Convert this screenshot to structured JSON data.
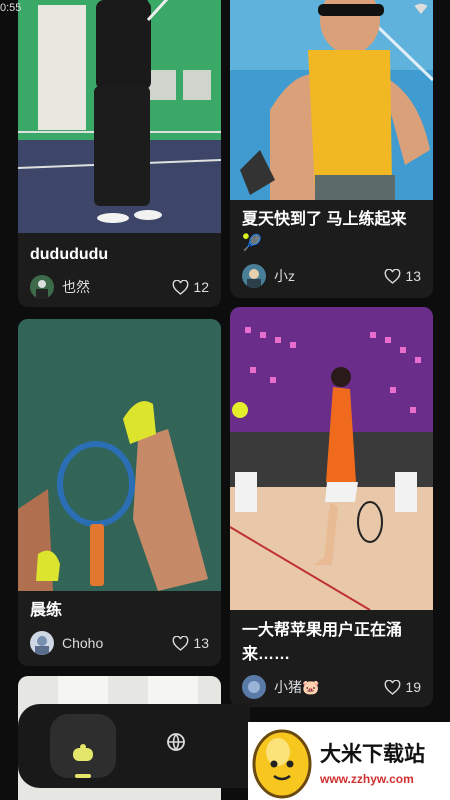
{
  "status": {
    "time": "0:55"
  },
  "feed": {
    "cards": [
      {
        "title": "dudududu",
        "author": "也然",
        "likes": "12"
      },
      {
        "title": "夏天快到了 马上练起来🎾",
        "author": "小z",
        "likes": "13"
      },
      {
        "title": "晨练",
        "author": "Choho",
        "likes": "13"
      },
      {
        "title": "一大帮苹果用户正在涌来……",
        "author": "小猪🐷",
        "likes": "19"
      }
    ]
  },
  "watermark": {
    "title": "大米下载站",
    "url": "www.zzhyw.com"
  },
  "colors": {
    "accent": "#e3e66a",
    "background": "#0d0d0d",
    "card": "#1c1c1c"
  }
}
